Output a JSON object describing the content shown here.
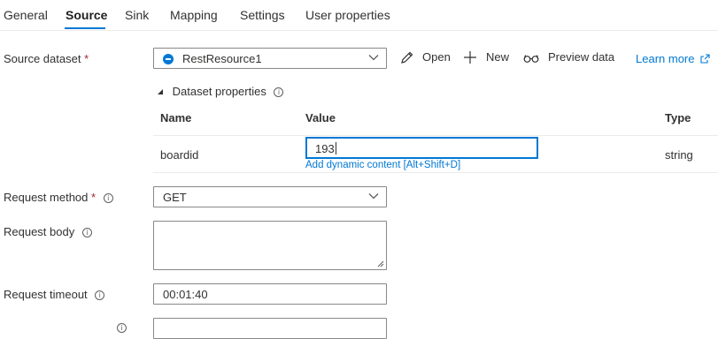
{
  "tabs": [
    "General",
    "Source",
    "Sink",
    "Mapping",
    "Settings",
    "User properties"
  ],
  "source_dataset": {
    "label": "Source dataset",
    "required_mark": "*",
    "selected": "RestResource1",
    "actions": {
      "open": "Open",
      "new": "New",
      "preview": "Preview data"
    },
    "learn_more": "Learn more"
  },
  "dataset_properties": {
    "title": "Dataset properties",
    "columns": {
      "name": "Name",
      "value": "Value",
      "type": "Type"
    },
    "rows": [
      {
        "name": "boardid",
        "value": "193",
        "type": "string",
        "dynamic_link": "Add dynamic content [Alt+Shift+D]"
      }
    ]
  },
  "request_method": {
    "label": "Request method",
    "required_mark": "*",
    "value": "GET"
  },
  "request_body": {
    "label": "Request body",
    "value": ""
  },
  "request_timeout": {
    "label": "Request timeout",
    "value": "00:01:40"
  },
  "colors": {
    "accent": "#0078d4",
    "required": "#a4262c",
    "text": "#323130"
  },
  "icons": [
    "dataset-icon",
    "chevron-down-icon",
    "edit-pencil-icon",
    "plus-icon",
    "glasses-icon",
    "external-link-icon",
    "info-icon",
    "collapse-triangle-icon",
    "resize-grip-icon"
  ]
}
